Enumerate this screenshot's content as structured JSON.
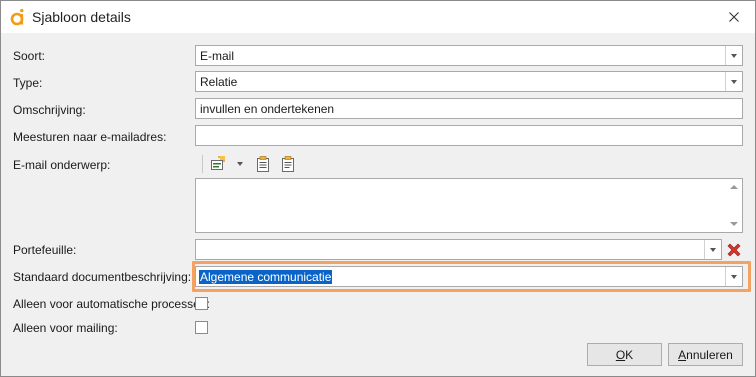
{
  "window": {
    "title": "Sjabloon details"
  },
  "form": {
    "soort": {
      "label": "Soort:",
      "value": "E-mail"
    },
    "type": {
      "label": "Type:",
      "value": "Relatie"
    },
    "omschrijving": {
      "label": "Omschrijving:",
      "value": "invullen en ondertekenen"
    },
    "meesturen": {
      "label": "Meesturen naar e-mailadres:",
      "value": ""
    },
    "email_onderwerp": {
      "label": "E-mail onderwerp:",
      "value": ""
    },
    "portefeuille": {
      "label": "Portefeuille:",
      "value": ""
    },
    "standaard_doc": {
      "label": "Standaard documentbeschrijving:",
      "value": "Algemene communicatie"
    },
    "alleen_auto": {
      "label": "Alleen voor automatische processen:",
      "checked": false
    },
    "alleen_mailing": {
      "label": "Alleen voor mailing:",
      "checked": false
    }
  },
  "buttons": {
    "ok_prefix": "O",
    "ok_rest": "K",
    "cancel_prefix": "A",
    "cancel_rest": "nnuleren"
  },
  "colors": {
    "highlight": "#f4a261",
    "selection": "#0a64c8",
    "delete_red": "#d9342b",
    "app_orange": "#f39c12"
  },
  "icons": {
    "app": "app-logo-icon",
    "close": "close-icon",
    "insert_field": "insert-field-icon",
    "clipboard_1": "clipboard-code-icon",
    "clipboard_2": "clipboard-text-icon",
    "delete": "delete-icon"
  }
}
